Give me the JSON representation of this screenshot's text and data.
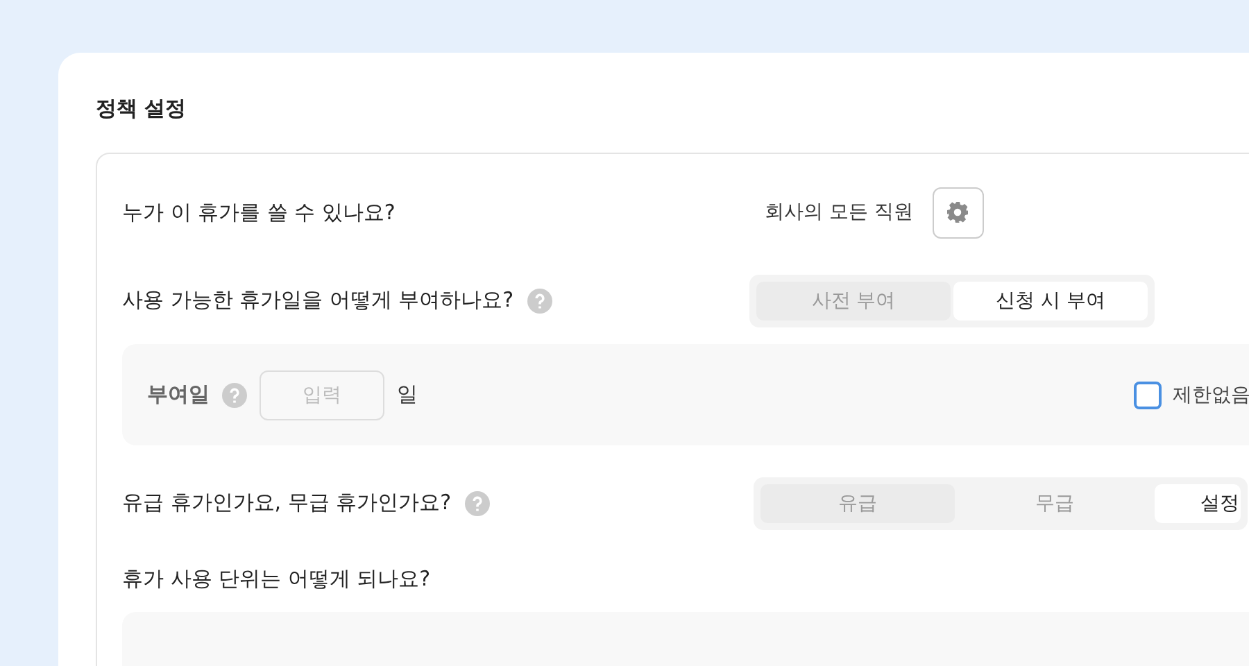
{
  "title": "정책 설정",
  "who": {
    "question": "누가 이 휴가를 쓸 수 있나요?",
    "value": "회사의 모든 직원"
  },
  "grant": {
    "question": "사용 가능한 휴가일을 어떻게 부여하나요?",
    "options": [
      {
        "label": "사전 부여",
        "selected": false
      },
      {
        "label": "신청 시 부여",
        "selected": true
      }
    ]
  },
  "grant_days": {
    "label": "부여일",
    "placeholder": "입력",
    "unit": "일",
    "unlimited": {
      "label": "제한없음",
      "checked": false
    }
  },
  "paid": {
    "question": "유급 휴가인가요, 무급 휴가인가요?",
    "options": [
      {
        "label": "유급",
        "selected": false
      },
      {
        "label": "무급",
        "selected": false
      },
      {
        "label": "설정",
        "selected": true
      }
    ]
  },
  "unit": {
    "question": "휴가 사용 단위는 어떻게 되나요?"
  }
}
